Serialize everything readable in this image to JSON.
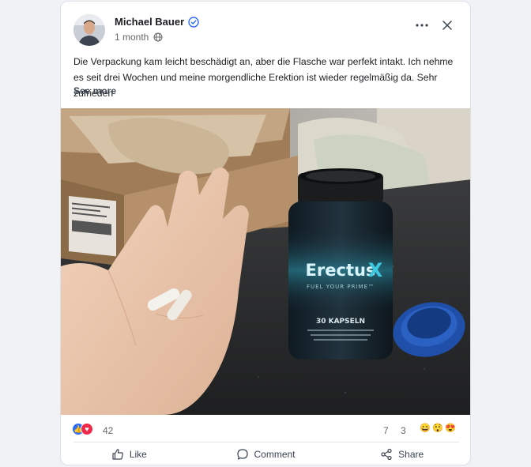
{
  "post": {
    "author": "Michael Bauer",
    "time": "1 month",
    "text": "Die Verpackung kam leicht beschädigt an, aber die Flasche war perfekt intakt. Ich nehme es seit drei Wochen und meine morgendliche Erektion ist wieder regelmäßig da. Sehr zufrieden",
    "see_more": "See more"
  },
  "product": {
    "brand_a": "Erectus",
    "brand_b": "X",
    "tagline": "FUEL YOUR PRIME™",
    "count": "30 KAPSELN"
  },
  "stats": {
    "reactions": "42",
    "comments": "7",
    "shares": "3"
  },
  "actions": {
    "like": "Like",
    "comment": "Comment",
    "share": "Share"
  },
  "icons": [
    "verified-icon",
    "globe-icon",
    "more-icon",
    "close-icon",
    "like-icon",
    "comment-icon",
    "share-icon"
  ],
  "colors": {
    "verified": "#2d6cf5",
    "like_reaction": "#2d6cf5",
    "love_reaction": "#f02849",
    "brand_teal": "#3fc7e0"
  }
}
